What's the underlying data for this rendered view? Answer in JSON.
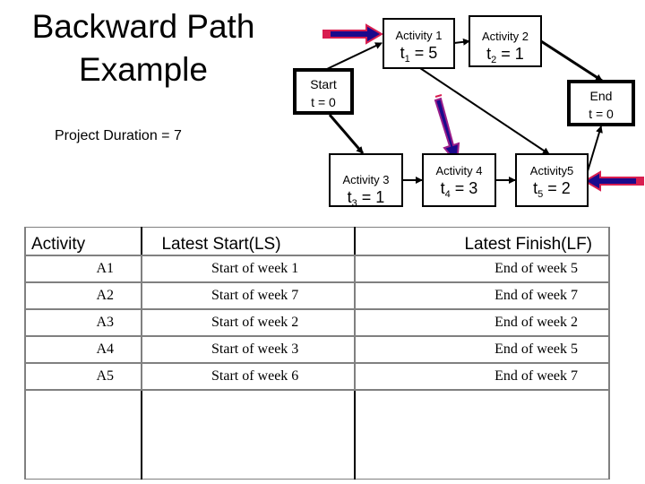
{
  "title": {
    "line1": "Backward Path",
    "line2": "Example"
  },
  "project_duration": "Project Duration = 7",
  "diagram": {
    "nodes": {
      "start": {
        "label": "Start",
        "value": "t = 0"
      },
      "end": {
        "label": "End",
        "value": "t = 0"
      },
      "a1": {
        "label": "Activity 1",
        "var": "t",
        "sub": "1",
        "eq": " = 5"
      },
      "a2": {
        "label": "Activity 2",
        "var": "t",
        "sub": "2",
        "eq": " = 1"
      },
      "a3": {
        "label": "Activity 3",
        "var": "t",
        "sub": "3",
        "eq": " = 1"
      },
      "a4": {
        "label": "Activity 4",
        "var": "t",
        "sub": "4",
        "eq": " = 3"
      },
      "a5": {
        "label": "Activity5",
        "var": "t",
        "sub": "5",
        "eq": " = 2"
      }
    },
    "edges": [
      [
        "start",
        "a1"
      ],
      [
        "start",
        "a3"
      ],
      [
        "a1",
        "a2"
      ],
      [
        "a1",
        "a5"
      ],
      [
        "a2",
        "end"
      ],
      [
        "a3",
        "a4"
      ],
      [
        "a4",
        "a5"
      ],
      [
        "a5",
        "end"
      ]
    ],
    "highlight_arrows": [
      {
        "target": "a1",
        "direction": "right"
      },
      {
        "target": "a4",
        "direction": "down"
      },
      {
        "target": "a5",
        "direction": "left"
      }
    ],
    "colors": {
      "arrow_fill": "#1a0a8c",
      "arrow_outline": "#d81e50",
      "line": "#000000"
    }
  },
  "table": {
    "headers": [
      "Activity",
      "Latest Start(LS)",
      "Latest Finish(LF)"
    ],
    "rows": [
      [
        "A1",
        "Start of week 1",
        "End of week 5"
      ],
      [
        "A2",
        "Start of week 7",
        "End of week 7"
      ],
      [
        "A3",
        "Start of week 2",
        "End of week 2"
      ],
      [
        "A4",
        "Start of week 3",
        "End of week 5"
      ],
      [
        "A5",
        "Start of week 6",
        "End of week 7"
      ]
    ]
  }
}
